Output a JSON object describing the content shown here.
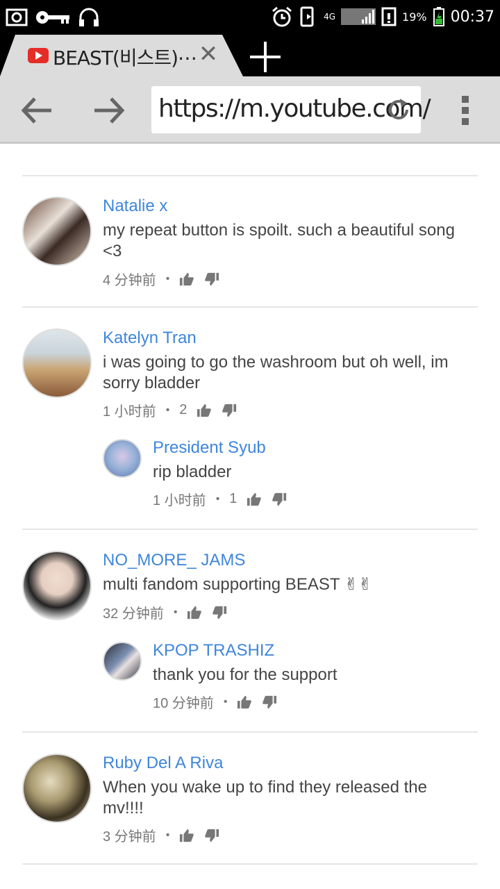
{
  "status_bar": {
    "battery": "19%",
    "time": "00:37",
    "network": "4G"
  },
  "browser": {
    "tab_title": "BEAST(비스트)⋯",
    "url": "https://m.youtube.com/"
  },
  "comments": [
    {
      "author": "Natalie x",
      "text": "my repeat button is spoilt. such a beautiful song <3",
      "time": "4 分钟前",
      "likes": "",
      "replies": []
    },
    {
      "author": "Katelyn Tran",
      "text": "i was going to go the washroom but oh well, im sorry bladder",
      "time": "1 小时前",
      "likes": "2",
      "replies": [
        {
          "author": "President Syub",
          "text": "rip bladder",
          "time": "1 小时前",
          "likes": "1"
        }
      ]
    },
    {
      "author": "NO_MORE_ JAMS",
      "text": "multi fandom supporting BEAST ✌✌",
      "time": "32 分钟前",
      "likes": "",
      "replies": [
        {
          "author": "KPOP TRASHIZ",
          "text": "thank you for the support",
          "time": "10 分钟前",
          "likes": ""
        }
      ]
    },
    {
      "author": "Ruby Del A Riva",
      "text": "When you wake up to find they released the mv!!!!",
      "time": "3 分钟前",
      "likes": "",
      "replies": []
    }
  ],
  "colors": {
    "author": "#3f86dc",
    "text": "#444444",
    "meta": "#777777"
  },
  "icons": {
    "like": "thumbs-up-icon",
    "dislike": "thumbs-down-icon"
  }
}
